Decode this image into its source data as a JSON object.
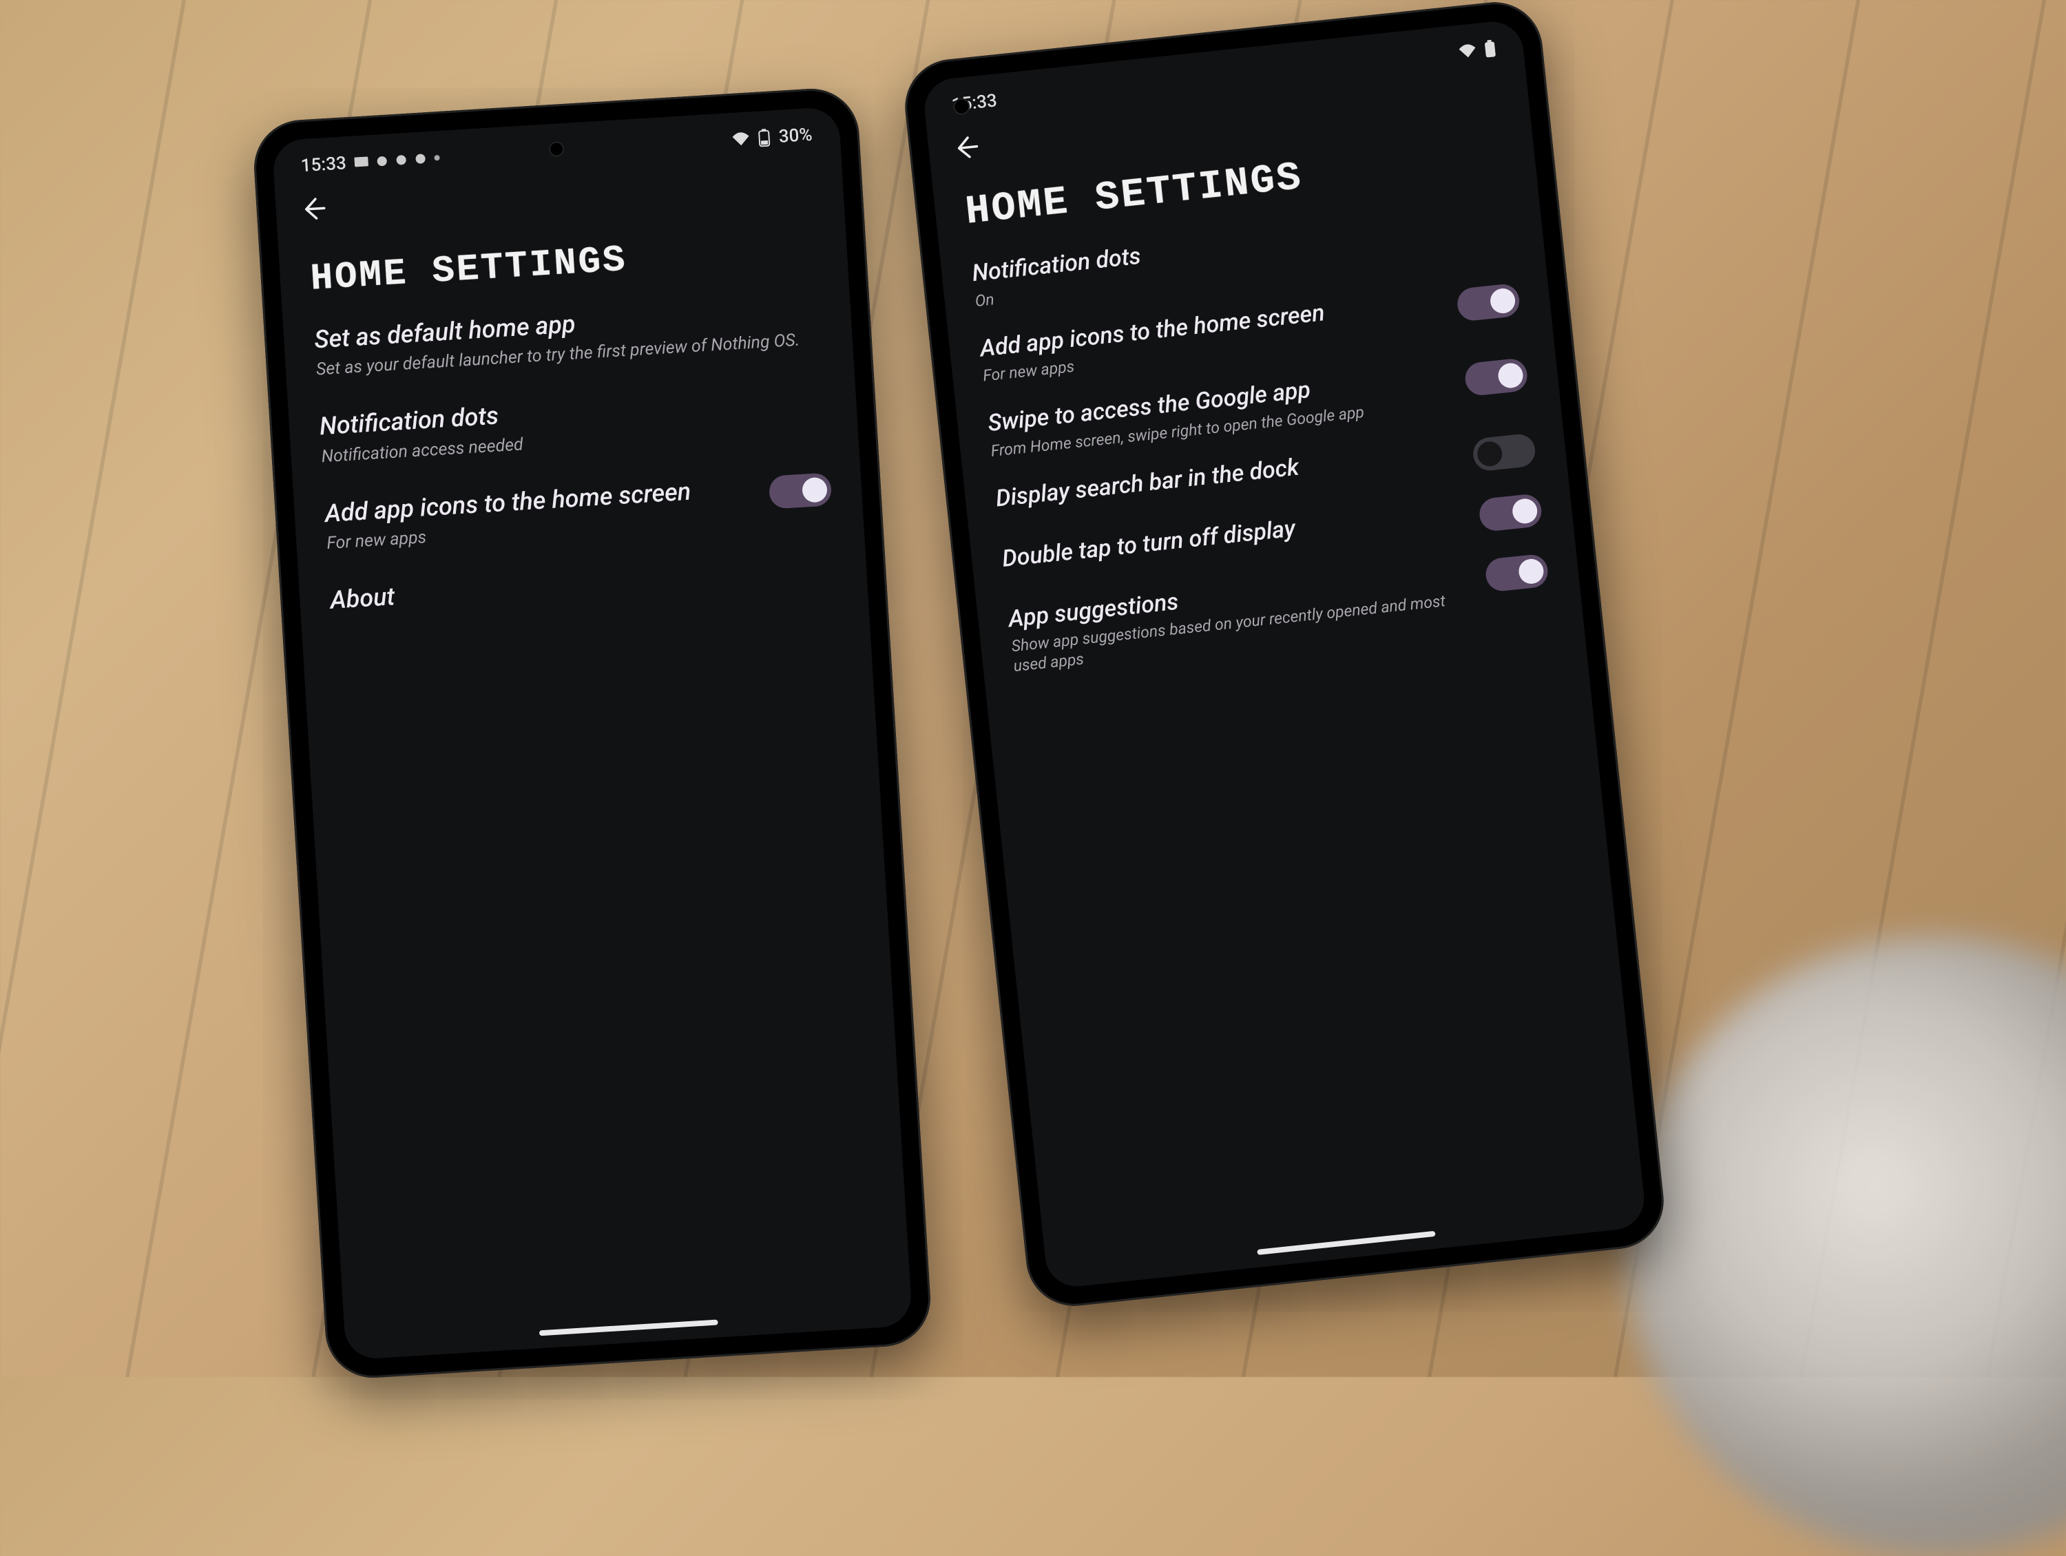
{
  "background": {
    "surface": "wooden-tabletop"
  },
  "phone_left": {
    "statusbar": {
      "time": "15:33",
      "battery_text": "30%"
    },
    "page_title": "HOME SETTINGS",
    "items": [
      {
        "key": "set_default",
        "label": "Set as default home app",
        "sub": "Set as your default launcher to try the first preview of Nothing OS.",
        "toggle": null
      },
      {
        "key": "notif_dots",
        "label": "Notification dots",
        "sub": "Notification access needed",
        "toggle": null
      },
      {
        "key": "add_icons",
        "label": "Add app icons to the home screen",
        "sub": "For new apps",
        "toggle": true
      },
      {
        "key": "about",
        "label": "About",
        "sub": "",
        "toggle": null
      }
    ]
  },
  "phone_right": {
    "statusbar": {
      "time": "15:33"
    },
    "page_title": "HOME SETTINGS",
    "items": [
      {
        "key": "notif_dots",
        "label": "Notification dots",
        "sub": "On",
        "toggle": null
      },
      {
        "key": "add_icons",
        "label": "Add app icons to the home screen",
        "sub": "For new apps",
        "toggle": true
      },
      {
        "key": "swipe_google",
        "label": "Swipe to access the Google app",
        "sub": "From Home screen, swipe right to open the Google app",
        "toggle": true
      },
      {
        "key": "dock_search",
        "label": "Display search bar in the dock",
        "sub": "",
        "toggle": false
      },
      {
        "key": "double_tap_off",
        "label": "Double tap to turn off display",
        "sub": "",
        "toggle": true
      },
      {
        "key": "app_suggestions",
        "label": "App suggestions",
        "sub": "Show app suggestions based on your recently opened and most used apps",
        "toggle": true
      }
    ]
  }
}
